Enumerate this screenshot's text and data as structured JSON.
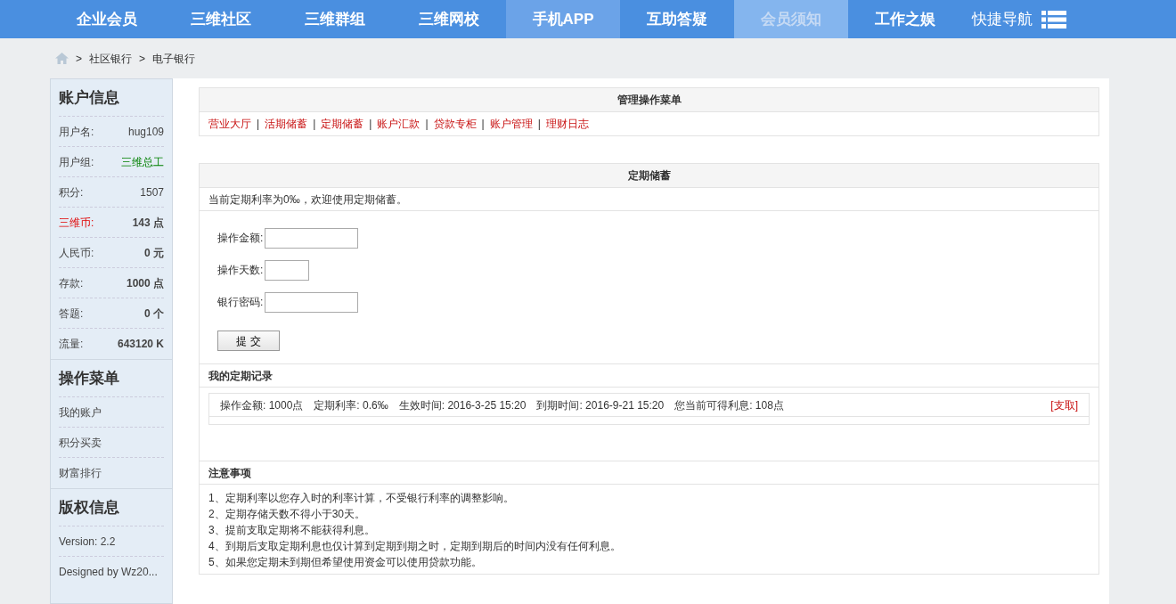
{
  "nav": [
    {
      "label": "企业会员",
      "selected": false,
      "hovered": false
    },
    {
      "label": "三维社区",
      "selected": false,
      "hovered": false
    },
    {
      "label": "三维群组",
      "selected": false,
      "hovered": false
    },
    {
      "label": "三维网校",
      "selected": false,
      "hovered": false
    },
    {
      "label": "手机APP",
      "selected": false,
      "hovered": true
    },
    {
      "label": "互助答疑",
      "selected": false,
      "hovered": false
    },
    {
      "label": "会员须知",
      "selected": true,
      "hovered": false
    },
    {
      "label": "工作之娱",
      "selected": false,
      "hovered": false
    },
    {
      "label": "快捷导航",
      "selected": false,
      "hovered": false,
      "kind": "menu"
    }
  ],
  "breadcrumb": [
    {
      "separator": ">",
      "label": "社区银行"
    },
    {
      "separator": ">",
      "label": "电子银行"
    }
  ],
  "sidebar": {
    "account": {
      "title": "账户信息",
      "rows": [
        {
          "label": "用户名:",
          "value": "hug109",
          "bold": false
        },
        {
          "label": "用户组:",
          "value": "三维总工",
          "bold": false,
          "kind": "group"
        },
        {
          "label": "积分:",
          "value": "1507",
          "bold": false
        },
        {
          "label": "三维币:",
          "value": "143 点",
          "bold": true,
          "kind": "currency"
        },
        {
          "label": "人民币:",
          "value": "0 元",
          "bold": true
        },
        {
          "label": "存款:",
          "value": "1000 点",
          "bold": true
        },
        {
          "label": "答题:",
          "value": "0 个",
          "bold": true
        },
        {
          "label": "流量:",
          "value": "643120 K",
          "bold": true
        }
      ]
    },
    "menu": {
      "title": "操作菜单",
      "items": [
        "我的账户",
        "积分买卖",
        "财富排行"
      ]
    },
    "copyright": {
      "title": "版权信息",
      "items": [
        "Version: 2.2",
        "Designed by Wz20..."
      ]
    }
  },
  "manage_menu": {
    "title": "管理操作菜单",
    "links": [
      "营业大厅",
      "活期储蓄",
      "定期储蓄",
      "账户汇款",
      "贷款专柜",
      "账户管理",
      "理财日志"
    ],
    "separator": "|"
  },
  "deposit": {
    "title": "定期储蓄",
    "intro": "当前定期利率为0‰，欢迎使用定期储蓄。",
    "fields": [
      {
        "label": "操作金额:",
        "kind": "amount"
      },
      {
        "label": "操作天数:",
        "kind": "days"
      },
      {
        "label": "银行密码:",
        "kind": "password"
      }
    ],
    "submit": "提 交",
    "records_title": "我的定期记录",
    "records": [
      {
        "text": "操作金额: 1000点　定期利率: 0.6‰　生效时间: 2016-3-25 15:20　到期时间: 2016-9-21 15:20　您当前可得利息: 108点",
        "action": "[支取]"
      }
    ],
    "notes_title": "注意事项",
    "notes": [
      "1、定期利率以您存入时的利率计算，不受银行利率的调整影响。",
      "2、定期存储天数不得小于30天。",
      "3、提前支取定期将不能获得利息。",
      "4、到期后支取定期利息也仅计算到定期到期之时，定期到期后的时间内没有任何利息。",
      "5、如果您定期未到期但希望使用资金可以使用贷款功能。"
    ]
  }
}
